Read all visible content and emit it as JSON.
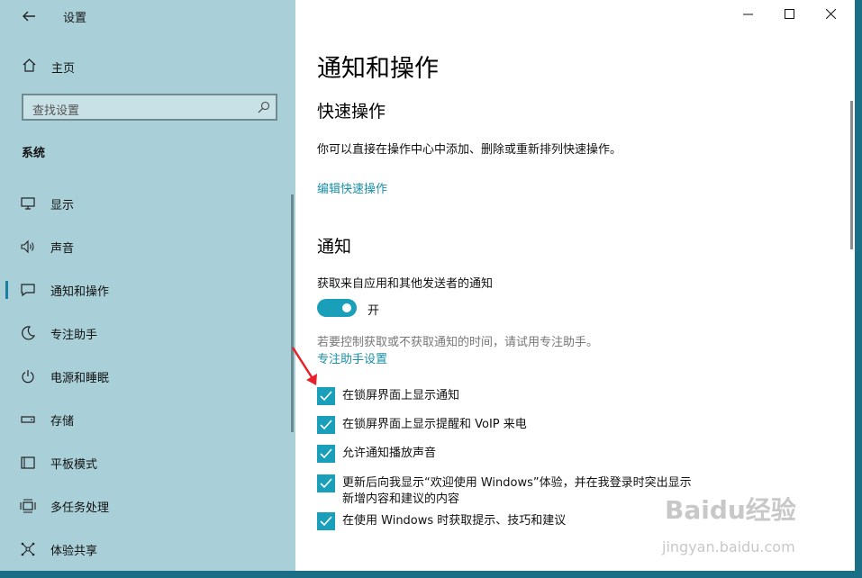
{
  "window": {
    "title": "设置"
  },
  "sidebar": {
    "home_label": "主页",
    "search_placeholder": "查找设置",
    "section_title": "系统",
    "items": [
      {
        "label": "显示",
        "icon": "monitor-icon"
      },
      {
        "label": "声音",
        "icon": "speaker-icon"
      },
      {
        "label": "通知和操作",
        "icon": "notification-icon",
        "active": true
      },
      {
        "label": "专注助手",
        "icon": "moon-icon"
      },
      {
        "label": "电源和睡眠",
        "icon": "power-icon"
      },
      {
        "label": "存储",
        "icon": "storage-icon"
      },
      {
        "label": "平板模式",
        "icon": "tablet-icon"
      },
      {
        "label": "多任务处理",
        "icon": "multitask-icon"
      },
      {
        "label": "体验共享",
        "icon": "share-icon"
      }
    ]
  },
  "main": {
    "page_title": "通知和操作",
    "quick_actions": {
      "heading": "快速操作",
      "description": "你可以直接在操作中心中添加、删除或重新排列快速操作。",
      "edit_link": "编辑快速操作"
    },
    "notifications": {
      "heading": "通知",
      "get_label": "获取来自应用和其他发送者的通知",
      "toggle_state": "开",
      "toggle_on": true,
      "hint": "若要控制获取或不获取通知的时间，请试用专注助手。",
      "focus_link": "专注助手设置",
      "checkboxes": [
        {
          "label": "在锁屏界面上显示通知",
          "checked": true
        },
        {
          "label": "在锁屏界面上显示提醒和 VoIP 来电",
          "checked": true
        },
        {
          "label": "允许通知播放声音",
          "checked": true
        },
        {
          "label": "更新后向我显示“欢迎使用 Windows”体验，并在我登录时突出显示",
          "label_line2": "新增内容和建议的内容",
          "checked": true
        },
        {
          "label": "在使用 Windows 时获取提示、技巧和建议",
          "checked": true
        }
      ]
    }
  },
  "colors": {
    "accent": "#1a9fba",
    "sidebar_bg": "#a9cfd8",
    "link": "#1a8fa8",
    "annotation_arrow": "#e8202a"
  },
  "watermark": {
    "logo_text": "Baidu经验",
    "url_text": "jingyan.baidu.com"
  }
}
